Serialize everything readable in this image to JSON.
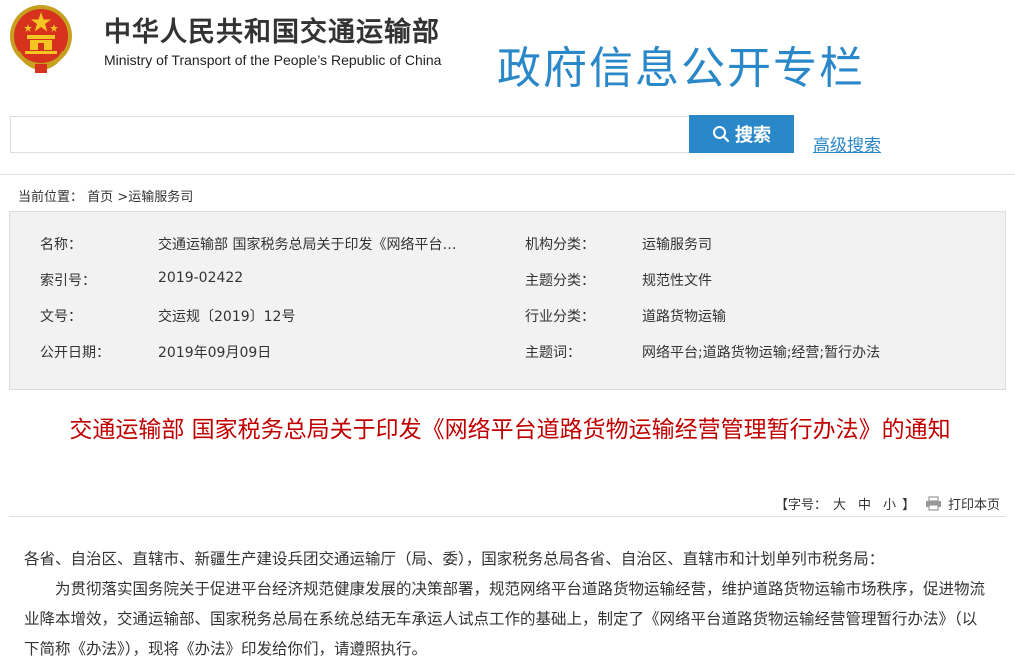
{
  "header": {
    "ministry_cn": "中华人民共和国交通运输部",
    "ministry_en": "Ministry of Transport of the People’s Republic of China",
    "column_title": "政府信息公开专栏",
    "accent_color": "#2a87c8"
  },
  "search": {
    "value": "",
    "button_label": "搜索",
    "advanced_label": "高级搜索"
  },
  "breadcrumb": {
    "prefix": "当前位置：",
    "home": "首页",
    "sep": ">",
    "current": "运输服务司"
  },
  "info": {
    "name_label": "名称：",
    "name_value": "交通运输部 国家税务总局关于印发《网络平台…",
    "index_label": "索引号：",
    "index_value": "2019-02422",
    "docno_label": "文号：",
    "docno_value": "交运规〔2019〕12号",
    "date_label": "公开日期：",
    "date_value": "2019年09月09日",
    "org_label": "机构分类：",
    "org_value": "运输服务司",
    "topic_label": "主题分类：",
    "topic_value": "规范性文件",
    "industry_label": "行业分类：",
    "industry_value": "道路货物运输",
    "keywords_label": "主题词：",
    "keywords_value": "网络平台;道路货物运输;经营;暂行办法"
  },
  "article": {
    "title": "交通运输部 国家税务总局关于印发《网络平台道路货物运输经营管理暂行办法》的通知",
    "title_color": "#c00000",
    "font_label_open": "【字号：",
    "font_large": "大",
    "font_medium": "中",
    "font_small": "小",
    "font_label_close": "】",
    "print_label": "打印本页",
    "para1": "各省、自治区、直辖市、新疆生产建设兵团交通运输厅（局、委），国家税务总局各省、自治区、直辖市和计划单列市税务局：",
    "para2": "为贯彻落实国务院关于促进平台经济规范健康发展的决策部署，规范网络平台道路货物运输经营，维护道路货物运输市场秩序，促进物流业降本增效，交通运输部、国家税务总局在系统总结无车承运人试点工作的基础上，制定了《网络平台道路货物运输经营管理暂行办法》（以下简称《办法》），现将《办法》印发给你们，请遵照执行。"
  }
}
